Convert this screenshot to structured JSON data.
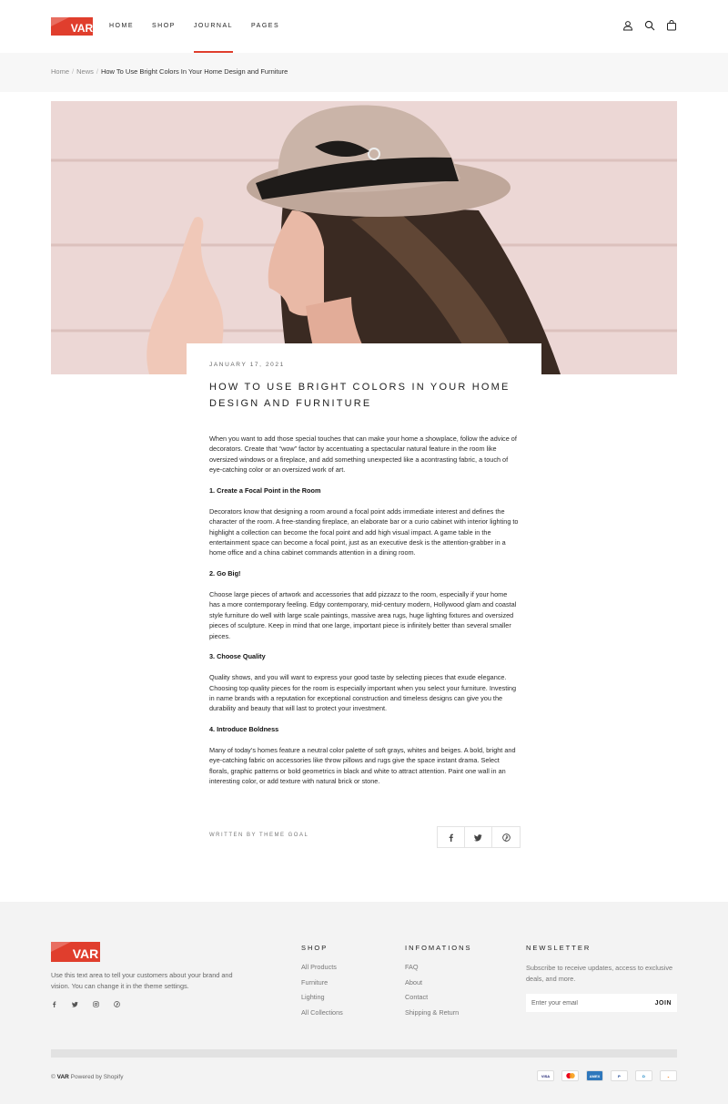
{
  "brand": {
    "logo_text": "VAR",
    "accent": "#e03e2d"
  },
  "nav": {
    "items": [
      {
        "label": "HOME"
      },
      {
        "label": "SHOP"
      },
      {
        "label": "JOURNAL"
      },
      {
        "label": "PAGES"
      }
    ],
    "active": "JOURNAL"
  },
  "header_icons": [
    "account-icon",
    "search-icon",
    "cart-icon"
  ],
  "breadcrumb": {
    "items": [
      "Home",
      "News",
      "How To Use Bright Colors In Your Home Design and Furniture"
    ],
    "separator": "/"
  },
  "article": {
    "date": "JANUARY 17, 2021",
    "title": "HOW TO USE BRIGHT COLORS IN YOUR HOME DESIGN AND FURNITURE",
    "intro": "When you want to add those special touches that can make your home a showplace, follow the advice of decorators. Create that “wow” factor by accentuating a spectacular natural feature in the room like oversized windows or a fireplace, and add something unexpected like a acontrasting fabric, a touch of eye-catching color or an oversized work of art.",
    "sections": [
      {
        "heading": "1. Create a Focal Point in the Room",
        "text": "Decorators know that designing a room around a focal point adds immediate interest and defines the character of the room. A free-standing fireplace, an elaborate bar or a curio cabinet with interior lighting to highlight a collection can become the focal point and add high visual impact. A game table in the entertainment space can become a focal point, just as an executive desk is the attention-grabber in a home office and a china cabinet commands attention in a dining room."
      },
      {
        "heading": "2. Go Big!",
        "text": "Choose large pieces of artwork and accessories that add pizzazz to the room, especially if your home has a more contemporary feeling. Edgy contemporary, mid-century modern, Hollywood glam and coastal style furniture do well with large scale paintings, massive area rugs, huge lighting fixtures and oversized pieces of sculpture. Keep in mind that one large, important piece is infinitely better than several smaller pieces."
      },
      {
        "heading": "3. Choose Quality",
        "text": "Quality shows, and you will want to express your good taste by selecting pieces that exude elegance. Choosing top quality pieces for the room is especially important when you select your furniture. Investing in name brands with a reputation for exceptional construction and timeless designs can give you the durability and beauty that will last to protect your investment."
      },
      {
        "heading": "4. Introduce Boldness",
        "text": "Many of today’s homes feature a neutral color palette of soft grays, whites and beiges. A bold, bright and eye-catching fabric on accessories like throw pillows and rugs give the space instant drama. Select florals, graphic patterns or bold geometrics in black and white to attract attention. Paint one wall in an interesting color, or add texture with natural brick or stone."
      }
    ],
    "written_by": "WRITTEN BY THEME GOAL",
    "share_icons": [
      "facebook-icon",
      "twitter-icon",
      "pinterest-icon"
    ]
  },
  "footer": {
    "about": "Use this text area to tell your customers about your brand and vision. You can change it in the theme settings.",
    "social_icons": [
      "facebook-icon",
      "twitter-icon",
      "instagram-icon",
      "pinterest-icon"
    ],
    "shop": {
      "heading": "SHOP",
      "links": [
        "All Products",
        "Furniture",
        "Lighting",
        "All Collections"
      ]
    },
    "info": {
      "heading": "INFOMATIONS",
      "links": [
        "FAQ",
        "About",
        "Contact",
        "Shipping & Return"
      ]
    },
    "newsletter": {
      "heading": "NEWSLETTER",
      "text": "Subscribe to receive updates, access to exclusive deals, and more.",
      "placeholder": "Enter your email",
      "button": "JOIN"
    },
    "copyright_symbol": "©",
    "copyright_brand": "VAR",
    "powered": "Powered by Shopify",
    "payments": [
      "VISA",
      "mastercard",
      "AMEX",
      "PayPal",
      "Diners",
      "Discover"
    ]
  }
}
